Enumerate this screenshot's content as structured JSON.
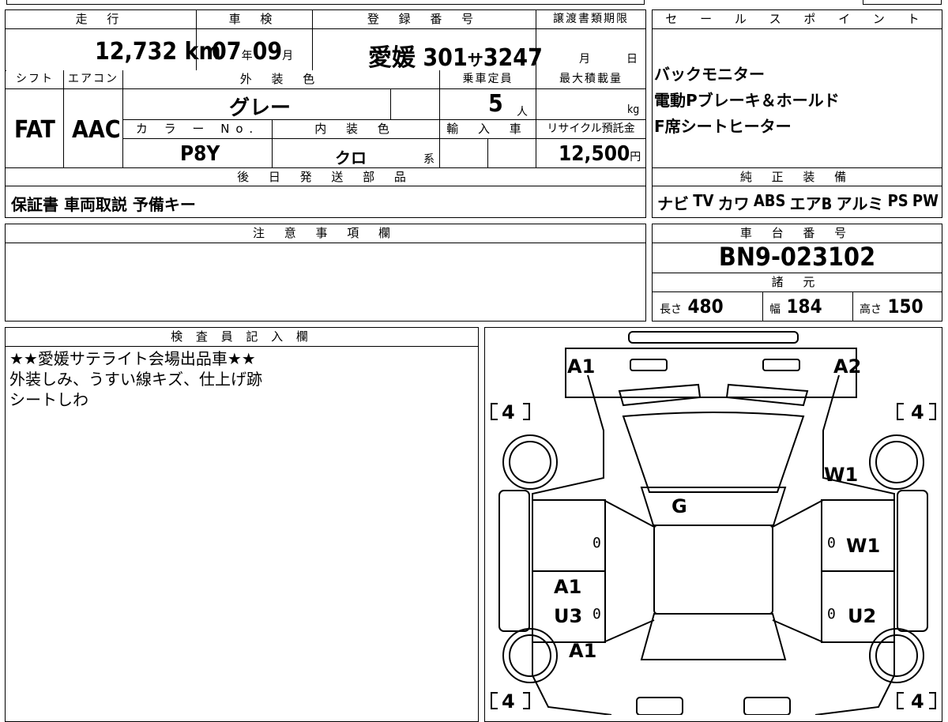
{
  "sheet": {
    "mileage": {
      "header": "走 行",
      "value": "12,732",
      "unit": "km"
    },
    "inspection": {
      "header": "車 検",
      "year": "07",
      "year_unit": "年",
      "month": "09",
      "month_unit": "月"
    },
    "registration": {
      "header": "登 録 番 号",
      "prefecture": "愛媛",
      "number": "301",
      "kana": "サ",
      "serial": "3247"
    },
    "transfer_deadline": {
      "header": "譲渡書類期限",
      "month_unit": "月",
      "day_unit": "日"
    },
    "shift": {
      "header": "シフト",
      "value": "FAT"
    },
    "aircon": {
      "header": "エアコン",
      "value": "AAC"
    },
    "exterior_color": {
      "header": "外 装 色",
      "value": "グレー"
    },
    "capacity": {
      "header": "乗車定員",
      "value": "5",
      "unit": "人"
    },
    "max_load": {
      "header": "最大積載量",
      "unit": "kg"
    },
    "color_no": {
      "header": "カ ラ ー No.",
      "value": "P8Y"
    },
    "interior_color": {
      "header": "内 装 色",
      "value": "クロ",
      "suffix": "系"
    },
    "import": {
      "header": "輸 入 車"
    },
    "recycle": {
      "header": "リサイクル預託金",
      "value": "12,500",
      "unit": "円"
    },
    "later_parts": {
      "header": "後 日 発 送 部 品",
      "value": "保証書 車両取説 予備キー"
    },
    "notes": {
      "header": "注 意 事 項 欄"
    },
    "sales_points": {
      "header": "セ ー ル ス ポ イ ン ト",
      "items": [
        "バックモニター",
        "電動Pブレーキ＆ホールド",
        "F席シートヒーター"
      ]
    },
    "equipment": {
      "header": "純 正 装 備",
      "items": [
        "ナビ",
        "TV",
        "カワ",
        "ABS",
        "エアB",
        "アルミ",
        "PS",
        "PW"
      ]
    },
    "chassis": {
      "header": "車 台 番 号",
      "value": "BN9-023102"
    },
    "specs": {
      "header": "諸 元",
      "length_label": "長さ",
      "length": "480",
      "width_label": "幅",
      "width": "184",
      "height_label": "高さ",
      "height": "150"
    },
    "inspector": {
      "header": "検 査 員 記 入 欄",
      "lines": [
        "★★愛媛サテライト会場出品車★★",
        "外装しみ、うすい線キズ、仕上げ跡",
        "シートしわ"
      ]
    }
  },
  "diagram": {
    "marks": [
      "A1",
      "A2",
      "W1",
      "G",
      "W1",
      "A1",
      "U3",
      "U2",
      "A1"
    ],
    "tire_depth": "4",
    "zeros": [
      "0",
      "0",
      "0",
      "0"
    ]
  }
}
